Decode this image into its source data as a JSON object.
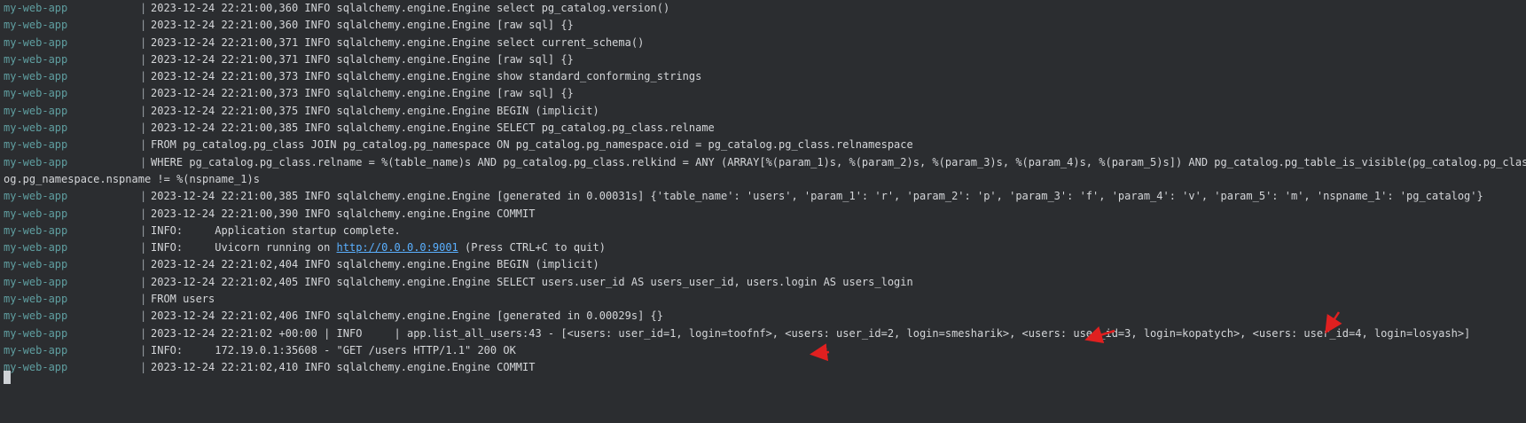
{
  "service": "my-web-app",
  "separator": "|",
  "lines": [
    {
      "kind": "log",
      "text": "2023-12-24 22:21:00,360 INFO sqlalchemy.engine.Engine select pg_catalog.version()"
    },
    {
      "kind": "log",
      "text": "2023-12-24 22:21:00,360 INFO sqlalchemy.engine.Engine [raw sql] {}"
    },
    {
      "kind": "log",
      "text": "2023-12-24 22:21:00,371 INFO sqlalchemy.engine.Engine select current_schema()"
    },
    {
      "kind": "log",
      "text": "2023-12-24 22:21:00,371 INFO sqlalchemy.engine.Engine [raw sql] {}"
    },
    {
      "kind": "log",
      "text": "2023-12-24 22:21:00,373 INFO sqlalchemy.engine.Engine show standard_conforming_strings"
    },
    {
      "kind": "log",
      "text": "2023-12-24 22:21:00,373 INFO sqlalchemy.engine.Engine [raw sql] {}"
    },
    {
      "kind": "log",
      "text": "2023-12-24 22:21:00,375 INFO sqlalchemy.engine.Engine BEGIN (implicit)"
    },
    {
      "kind": "log",
      "text": "2023-12-24 22:21:00,385 INFO sqlalchemy.engine.Engine SELECT pg_catalog.pg_class.relname"
    },
    {
      "kind": "log",
      "text": "FROM pg_catalog.pg_class JOIN pg_catalog.pg_namespace ON pg_catalog.pg_namespace.oid = pg_catalog.pg_class.relnamespace"
    },
    {
      "kind": "log",
      "text": "WHERE pg_catalog.pg_class.relname = %(table_name)s AND pg_catalog.pg_class.relkind = ANY (ARRAY[%(param_1)s, %(param_2)s, %(param_3)s, %(param_4)s, %(param_5)s]) AND pg_catalog.pg_table_is_visible(pg_catalog.pg_class.oid) AND pg_catal"
    },
    {
      "kind": "wrap",
      "text": "og.pg_namespace.nspname != %(nspname_1)s"
    },
    {
      "kind": "log",
      "text": "2023-12-24 22:21:00,385 INFO sqlalchemy.engine.Engine [generated in 0.00031s] {'table_name': 'users', 'param_1': 'r', 'param_2': 'p', 'param_3': 'f', 'param_4': 'v', 'param_5': 'm', 'nspname_1': 'pg_catalog'}"
    },
    {
      "kind": "log",
      "text": "2023-12-24 22:21:00,390 INFO sqlalchemy.engine.Engine COMMIT"
    },
    {
      "kind": "log",
      "text": "INFO:     Application startup complete."
    },
    {
      "kind": "link",
      "before": "INFO:     Uvicorn running on ",
      "link": "http://0.0.0.0:9001",
      "after": " (Press CTRL+C to quit)"
    },
    {
      "kind": "log",
      "text": "2023-12-24 22:21:02,404 INFO sqlalchemy.engine.Engine BEGIN (implicit)"
    },
    {
      "kind": "log",
      "text": "2023-12-24 22:21:02,405 INFO sqlalchemy.engine.Engine SELECT users.user_id AS users_user_id, users.login AS users_login"
    },
    {
      "kind": "log",
      "text": "FROM users"
    },
    {
      "kind": "log",
      "text": "2023-12-24 22:21:02,406 INFO sqlalchemy.engine.Engine [generated in 0.00029s] {}"
    },
    {
      "kind": "log",
      "text": "2023-12-24 22:21:02 +00:00 | INFO     | app.list_all_users:43 - [<users: user_id=1, login=toofnf>, <users: user_id=2, login=smesharik>, <users: user_id=3, login=kopatych>, <users: user_id=4, login=losyash>]"
    },
    {
      "kind": "log",
      "text": "INFO:     172.19.0.1:35608 - \"GET /users HTTP/1.1\" 200 OK"
    },
    {
      "kind": "log",
      "text": "2023-12-24 22:21:02,410 INFO sqlalchemy.engine.Engine COMMIT"
    }
  ],
  "colors": {
    "background": "#2b2d30",
    "service": "#5f9ea0",
    "text": "#d4d6d9",
    "link": "#5ab0ff",
    "annotation_arrow": "#e02020"
  },
  "icons": [
    "red-arrow-icon",
    "cursor-block"
  ]
}
